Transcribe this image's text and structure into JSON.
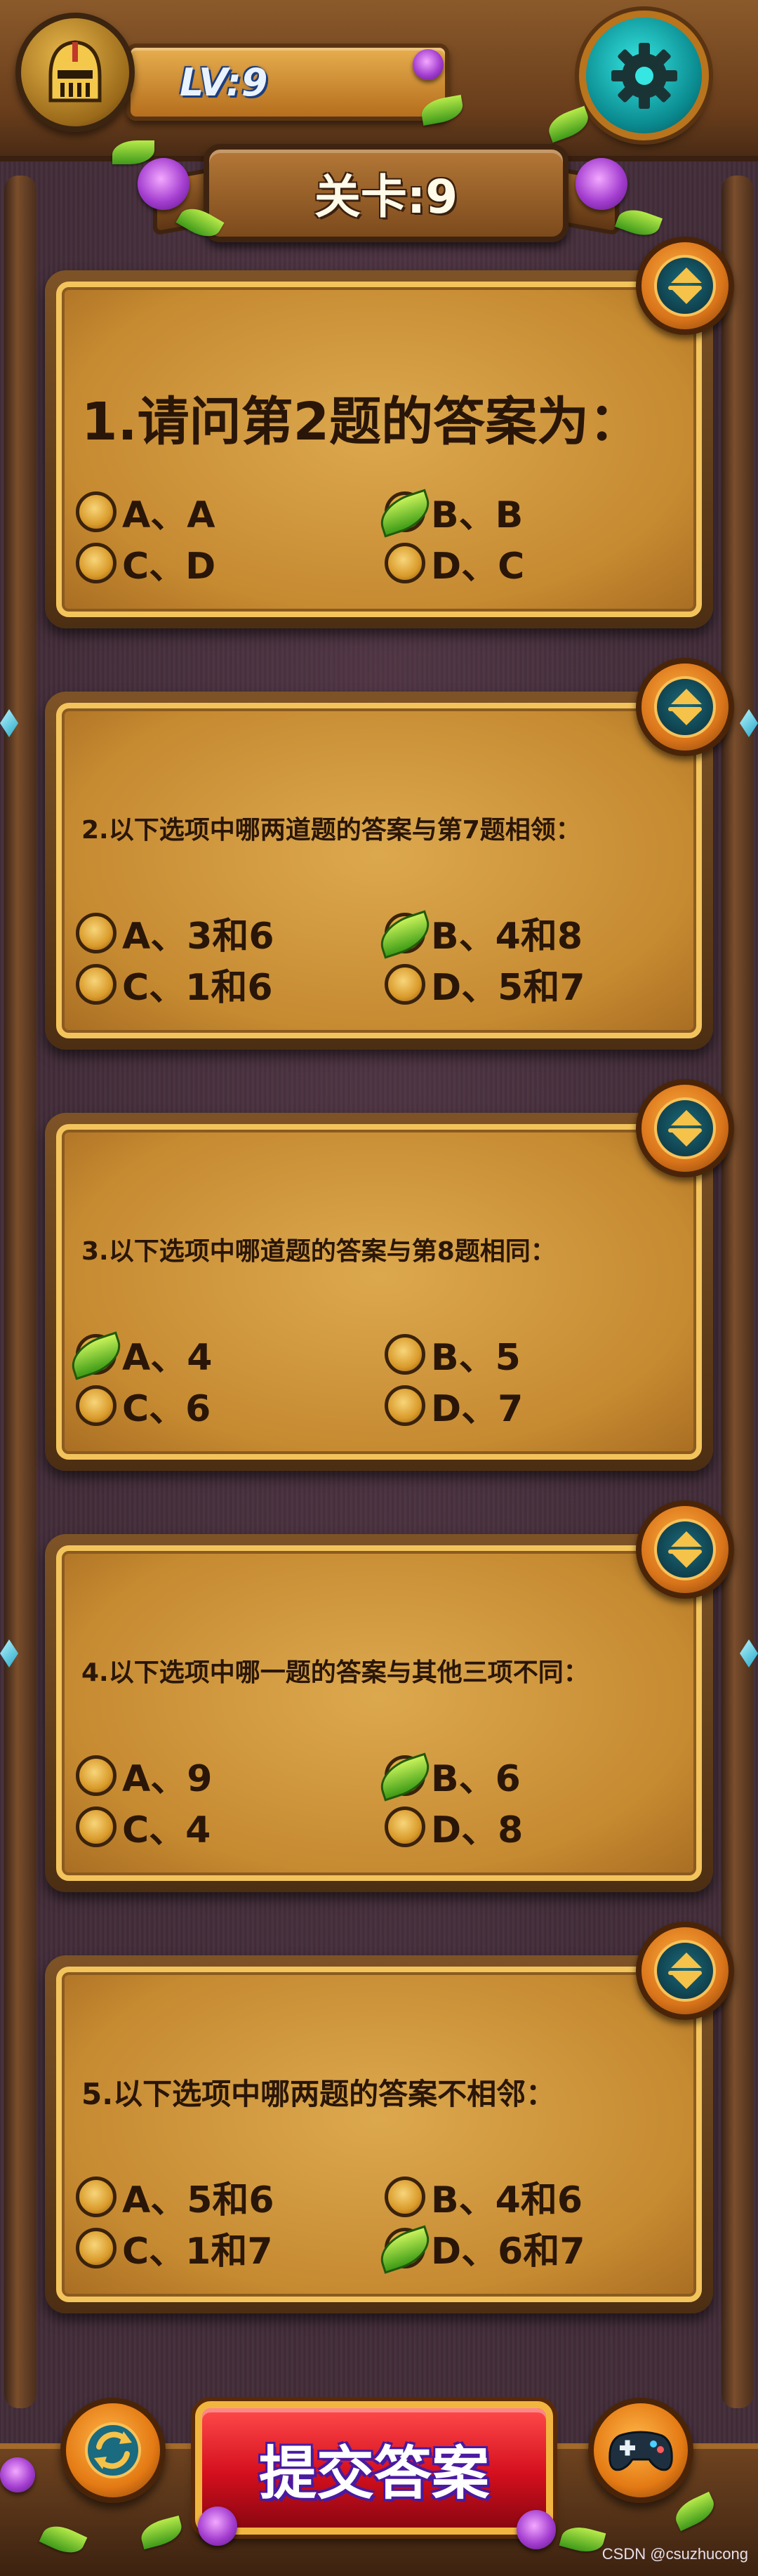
{
  "header": {
    "level_label": "LV:9",
    "stage_label": "关卡:9"
  },
  "questions": [
    {
      "text": "1.请问第2题的答案为：",
      "options": [
        {
          "label": "A、A",
          "selected": false
        },
        {
          "label": "B、B",
          "selected": true
        },
        {
          "label": "C、D",
          "selected": false
        },
        {
          "label": "D、C",
          "selected": false
        }
      ]
    },
    {
      "text": "2.以下选项中哪两道题的答案与第7题相领：",
      "options": [
        {
          "label": "A、3和6",
          "selected": false
        },
        {
          "label": "B、4和8",
          "selected": true
        },
        {
          "label": "C、1和6",
          "selected": false
        },
        {
          "label": "D、5和7",
          "selected": false
        }
      ]
    },
    {
      "text": "3.以下选项中哪道题的答案与第8题相同：",
      "options": [
        {
          "label": "A、4",
          "selected": true
        },
        {
          "label": "B、5",
          "selected": false
        },
        {
          "label": "C、6",
          "selected": false
        },
        {
          "label": "D、7",
          "selected": false
        }
      ]
    },
    {
      "text": "4.以下选项中哪一题的答案与其他三项不同：",
      "options": [
        {
          "label": "A、9",
          "selected": false
        },
        {
          "label": "B、6",
          "selected": true
        },
        {
          "label": "C、4",
          "selected": false
        },
        {
          "label": "D、8",
          "selected": false
        }
      ]
    },
    {
      "text": "5.以下选项中哪两题的答案不相邻：",
      "options": [
        {
          "label": "A、5和6",
          "selected": false
        },
        {
          "label": "B、4和6",
          "selected": false
        },
        {
          "label": "C、1和7",
          "selected": false
        },
        {
          "label": "D、6和7",
          "selected": true
        }
      ]
    }
  ],
  "footer": {
    "submit_label": "提交答案",
    "watermark": "CSDN @csuzhucong"
  },
  "icons": {
    "avatar": "knight-helmet-icon",
    "settings": "gear-icon",
    "collapse": "collapse-toggle-icon",
    "refresh": "refresh-icon",
    "gamepad": "gamepad-icon",
    "selected_marker": "leaf-icon"
  },
  "colors": {
    "card": "#c68a31",
    "card_border": "#f3c45c",
    "submit_button": "#d40f1e",
    "settings_button": "#0a8a8f",
    "level_text": "#e9f3ff"
  }
}
